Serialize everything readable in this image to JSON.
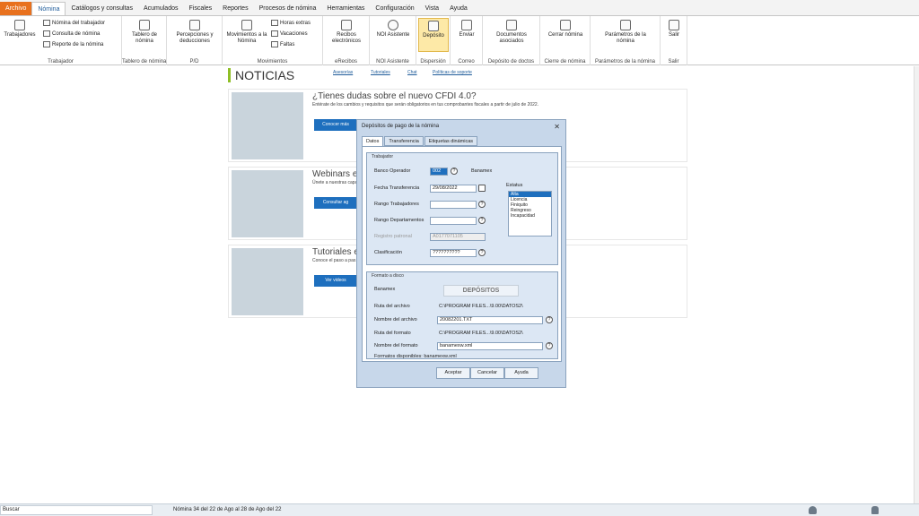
{
  "menu": [
    "Archivo",
    "Nómina",
    "Catálogos y consultas",
    "Acumulados",
    "Fiscales",
    "Reportes",
    "Procesos de nómina",
    "Herramientas",
    "Configuración",
    "Vista",
    "Ayuda"
  ],
  "ribbon": {
    "trabajadores": "Trabajadores",
    "nomina_trab": "Nómina del trabajador",
    "consulta_nomina": "Consulta de nómina",
    "reporte_nomina": "Reporte de la nómina",
    "g_trabajador": "Trabajador",
    "tablero": "Tablero de nómina",
    "g_tablero": "Tablero de nómina",
    "percepciones": "Percepciones y deducciones",
    "g_pd": "P/D",
    "movimientos": "Movimientos a la Nómina",
    "horas": "Horas extras",
    "vacaciones": "Vacaciones",
    "faltas": "Faltas",
    "g_mov": "Movimientos",
    "recibos": "Recibos electrónicos",
    "g_efecibos": "eRecibos",
    "noi": "NOI Asistente",
    "g_noi": "NOI Asistente",
    "deposito": "Depósito",
    "g_dispersion": "Dispersión",
    "enviar": "Enviar",
    "g_correo": "Correo",
    "documentos": "Documentos asociados",
    "g_docs": "Depósito de doctos",
    "cerrar": "Cerrar nómina",
    "g_cierre": "Cierre de nómina",
    "parametros": "Parámetros de la nómina",
    "g_param": "Parámetros de la nómina",
    "salir": "Salir",
    "g_salir": "Salir"
  },
  "news": {
    "title": "NOTICIAS",
    "links": [
      "Asesorías",
      "Tutoriales",
      "Chat",
      "Políticas de soporte"
    ],
    "cards": [
      {
        "h": "¿Tienes dudas sobre el nuevo CFDI 4.0?",
        "p": "Entérate de los cambios y requisitos que serán obligatorios en tus comprobantes fiscales a partir de julio de 2022.",
        "btn": "Conocer más"
      },
      {
        "h": "Webinars en",
        "p": "Únete a nuestras capa",
        "btn": "Consultar ag"
      },
      {
        "h": "Tutoriales e",
        "p": "Conoce el paso a pas",
        "btn": "Ver videos"
      }
    ]
  },
  "status": {
    "search": "Buscar",
    "info": "Nómina  34 del 22 de Ago al 28 de Ago del 22"
  },
  "dialog": {
    "title": "Depósitos de pago de la nómina",
    "close": "✕",
    "tabs": [
      "Datos",
      "Transferencia",
      "Etiquetas dinámicas"
    ],
    "trabajador_legend": "Trabajador",
    "banco_label": "Banco Operador",
    "banco_value": "002",
    "banco_name": "Banamex",
    "fecha_label": "Fecha Transferencia",
    "fecha_value": "29/08/2022",
    "rango_trab_label": "Rango Trabajadores",
    "rango_trab_value": "",
    "rango_dep_label": "Rango Departamentos",
    "rango_dep_value": "",
    "registro_label": "Registro patronal",
    "registro_value": "A0177071105",
    "clasif_label": "Clasificación",
    "clasif_value": "??????????",
    "estatus_legend": "Estatus",
    "estatus": [
      "Alta",
      "Licencia",
      "Finiquito",
      "Reingreso",
      "Incapacidad"
    ],
    "formato_legend": "Formato a disco",
    "formato_bank": "Banamex",
    "logo": "DEPÓSITOS",
    "ruta_archivo_label": "Ruta del archivo",
    "ruta_archivo": "C:\\PROGRAM FILES...\\9.00\\DATOS2\\",
    "nombre_archivo_label": "Nombre del archivo",
    "nombre_archivo": "20082201.TXT",
    "ruta_formato_label": "Ruta del formato",
    "ruta_formato": "C:\\PROGRAM FILES...\\9.00\\DATOS2\\",
    "nombre_formato_label": "Nombre del formato",
    "nombre_formato": "banamexw.xml",
    "disponibles": "Formatos disponibles: banamexw.xml",
    "aceptar": "Aceptar",
    "cancelar": "Cancelar",
    "ayuda": "Ayuda",
    "help": "?"
  }
}
